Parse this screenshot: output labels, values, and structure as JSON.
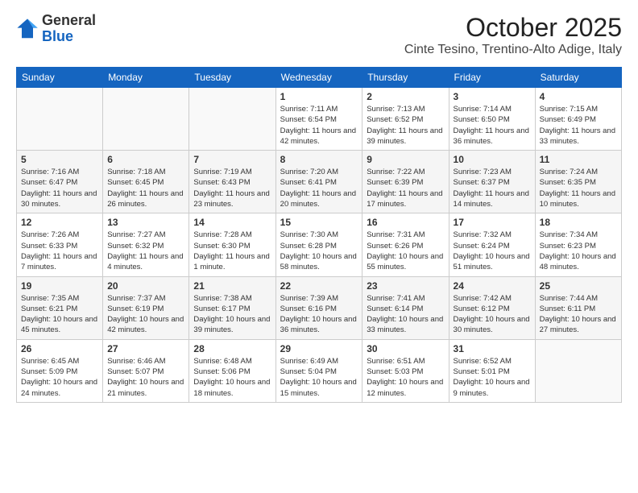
{
  "header": {
    "logo_general": "General",
    "logo_blue": "Blue",
    "month_title": "October 2025",
    "location": "Cinte Tesino, Trentino-Alto Adige, Italy"
  },
  "weekdays": [
    "Sunday",
    "Monday",
    "Tuesday",
    "Wednesday",
    "Thursday",
    "Friday",
    "Saturday"
  ],
  "weeks": [
    [
      {
        "day": "",
        "info": ""
      },
      {
        "day": "",
        "info": ""
      },
      {
        "day": "",
        "info": ""
      },
      {
        "day": "1",
        "info": "Sunrise: 7:11 AM\nSunset: 6:54 PM\nDaylight: 11 hours and 42 minutes."
      },
      {
        "day": "2",
        "info": "Sunrise: 7:13 AM\nSunset: 6:52 PM\nDaylight: 11 hours and 39 minutes."
      },
      {
        "day": "3",
        "info": "Sunrise: 7:14 AM\nSunset: 6:50 PM\nDaylight: 11 hours and 36 minutes."
      },
      {
        "day": "4",
        "info": "Sunrise: 7:15 AM\nSunset: 6:49 PM\nDaylight: 11 hours and 33 minutes."
      }
    ],
    [
      {
        "day": "5",
        "info": "Sunrise: 7:16 AM\nSunset: 6:47 PM\nDaylight: 11 hours and 30 minutes."
      },
      {
        "day": "6",
        "info": "Sunrise: 7:18 AM\nSunset: 6:45 PM\nDaylight: 11 hours and 26 minutes."
      },
      {
        "day": "7",
        "info": "Sunrise: 7:19 AM\nSunset: 6:43 PM\nDaylight: 11 hours and 23 minutes."
      },
      {
        "day": "8",
        "info": "Sunrise: 7:20 AM\nSunset: 6:41 PM\nDaylight: 11 hours and 20 minutes."
      },
      {
        "day": "9",
        "info": "Sunrise: 7:22 AM\nSunset: 6:39 PM\nDaylight: 11 hours and 17 minutes."
      },
      {
        "day": "10",
        "info": "Sunrise: 7:23 AM\nSunset: 6:37 PM\nDaylight: 11 hours and 14 minutes."
      },
      {
        "day": "11",
        "info": "Sunrise: 7:24 AM\nSunset: 6:35 PM\nDaylight: 11 hours and 10 minutes."
      }
    ],
    [
      {
        "day": "12",
        "info": "Sunrise: 7:26 AM\nSunset: 6:33 PM\nDaylight: 11 hours and 7 minutes."
      },
      {
        "day": "13",
        "info": "Sunrise: 7:27 AM\nSunset: 6:32 PM\nDaylight: 11 hours and 4 minutes."
      },
      {
        "day": "14",
        "info": "Sunrise: 7:28 AM\nSunset: 6:30 PM\nDaylight: 11 hours and 1 minute."
      },
      {
        "day": "15",
        "info": "Sunrise: 7:30 AM\nSunset: 6:28 PM\nDaylight: 10 hours and 58 minutes."
      },
      {
        "day": "16",
        "info": "Sunrise: 7:31 AM\nSunset: 6:26 PM\nDaylight: 10 hours and 55 minutes."
      },
      {
        "day": "17",
        "info": "Sunrise: 7:32 AM\nSunset: 6:24 PM\nDaylight: 10 hours and 51 minutes."
      },
      {
        "day": "18",
        "info": "Sunrise: 7:34 AM\nSunset: 6:23 PM\nDaylight: 10 hours and 48 minutes."
      }
    ],
    [
      {
        "day": "19",
        "info": "Sunrise: 7:35 AM\nSunset: 6:21 PM\nDaylight: 10 hours and 45 minutes."
      },
      {
        "day": "20",
        "info": "Sunrise: 7:37 AM\nSunset: 6:19 PM\nDaylight: 10 hours and 42 minutes."
      },
      {
        "day": "21",
        "info": "Sunrise: 7:38 AM\nSunset: 6:17 PM\nDaylight: 10 hours and 39 minutes."
      },
      {
        "day": "22",
        "info": "Sunrise: 7:39 AM\nSunset: 6:16 PM\nDaylight: 10 hours and 36 minutes."
      },
      {
        "day": "23",
        "info": "Sunrise: 7:41 AM\nSunset: 6:14 PM\nDaylight: 10 hours and 33 minutes."
      },
      {
        "day": "24",
        "info": "Sunrise: 7:42 AM\nSunset: 6:12 PM\nDaylight: 10 hours and 30 minutes."
      },
      {
        "day": "25",
        "info": "Sunrise: 7:44 AM\nSunset: 6:11 PM\nDaylight: 10 hours and 27 minutes."
      }
    ],
    [
      {
        "day": "26",
        "info": "Sunrise: 6:45 AM\nSunset: 5:09 PM\nDaylight: 10 hours and 24 minutes."
      },
      {
        "day": "27",
        "info": "Sunrise: 6:46 AM\nSunset: 5:07 PM\nDaylight: 10 hours and 21 minutes."
      },
      {
        "day": "28",
        "info": "Sunrise: 6:48 AM\nSunset: 5:06 PM\nDaylight: 10 hours and 18 minutes."
      },
      {
        "day": "29",
        "info": "Sunrise: 6:49 AM\nSunset: 5:04 PM\nDaylight: 10 hours and 15 minutes."
      },
      {
        "day": "30",
        "info": "Sunrise: 6:51 AM\nSunset: 5:03 PM\nDaylight: 10 hours and 12 minutes."
      },
      {
        "day": "31",
        "info": "Sunrise: 6:52 AM\nSunset: 5:01 PM\nDaylight: 10 hours and 9 minutes."
      },
      {
        "day": "",
        "info": ""
      }
    ]
  ]
}
